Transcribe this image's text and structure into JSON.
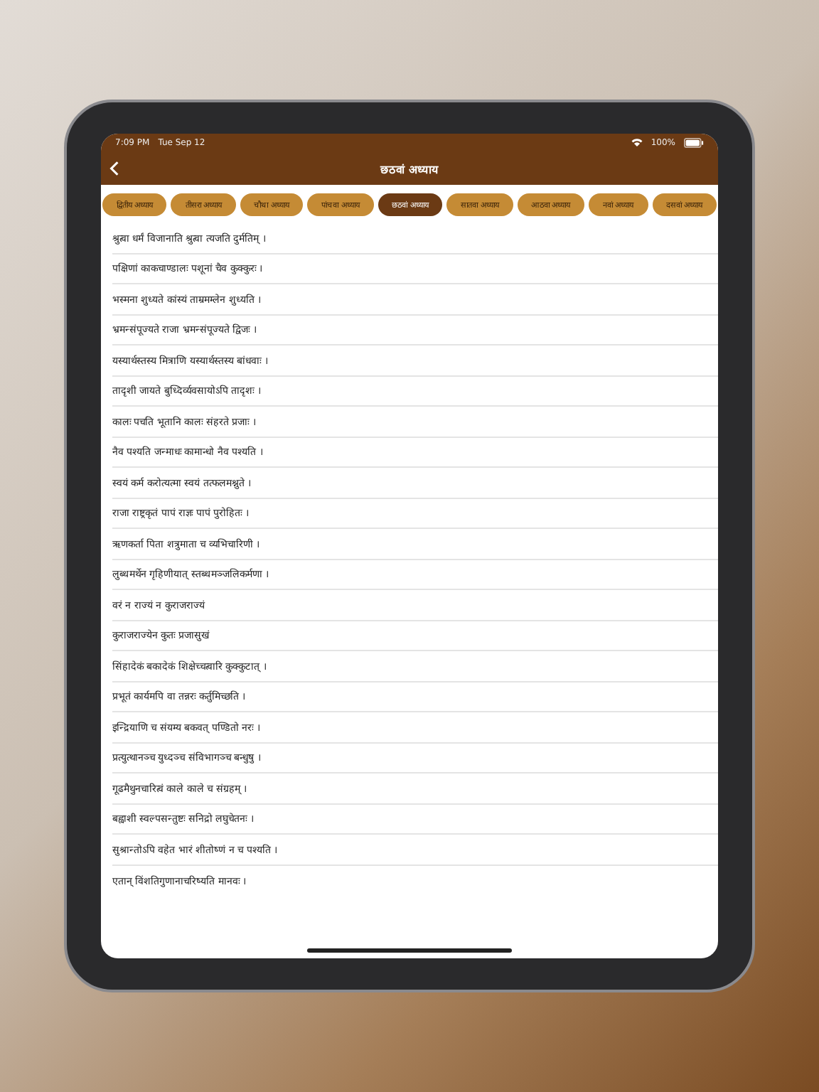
{
  "status_bar": {
    "time": "7:09 PM",
    "date": "Tue Sep 12",
    "battery": "100%"
  },
  "nav_bar": {
    "title": "छठवां अध्याय"
  },
  "tabs": [
    {
      "label": "द्वितीय अध्याय",
      "selected": false
    },
    {
      "label": "तीसरा अध्याय",
      "selected": false
    },
    {
      "label": "चौथा अध्याय",
      "selected": false
    },
    {
      "label": "पांचवा अध्याय",
      "selected": false
    },
    {
      "label": "छठवां अध्याय",
      "selected": true
    },
    {
      "label": "सातवा अध्याय",
      "selected": false
    },
    {
      "label": "आठवा अध्याय",
      "selected": false
    },
    {
      "label": "नवां अध्याय",
      "selected": false
    },
    {
      "label": "दसवां अध्याय",
      "selected": false
    }
  ],
  "verses": [
    "श्रुत्वा धर्मं विजानाति श्रुत्वा त्यजति दुर्मतिम् ।",
    "पक्षिणां काकचाण्डालः पशूनां चैव कुक्कुरः ।",
    "भस्मना शुध्यते कांस्यं ताम्रमम्लेन शुध्यति ।",
    "भ्रमन्संपूज्यते राजा भ्रमन्संपूज्यते द्विजः ।",
    "यस्यार्थस्तस्य मित्राणि यस्यार्थस्तस्य बांधवाः ।",
    "तादृशी जायते बुध्दिर्व्यवसायोऽपि तादृशः ।",
    "कालः पचति भूतानि कालः संहरते प्रजाः ।",
    "नैव पश्यति जन्माधः कामान्धो नैव पश्यति ।",
    "स्वयं कर्म करोत्यत्मा स्वयं तत्फलमश्नुते ।",
    "राजा राष्ट्रकृतं पापं राज्ञः पापं पुरोहितः ।",
    "ऋणकर्ता पिता शत्रुमाता च व्यभिचारिणी ।",
    "लुब्धमर्थेन गृहिणीयात् स्तब्धमञ्जलिकर्मणा ।",
    "वरं न राज्यं न कुराजराज्यं",
    "कुराजराज्येन कुतः प्रजासुखं",
    "सिंहादेकं बकादेकं शिक्षेच्चत्वारि कुक्कुटात् ।",
    "प्रभूतं कार्यमपि वा तन्नरः कर्तुमिच्छति ।",
    "इन्द्रियाणि च संयम्य बकवत् पण्डितो नरः ।",
    "प्रत्युत्थानञ्च युध्दञ्च संविभागञ्च बन्धुषु ।",
    "गूढमैथुनचारित्वं काले काले च संग्रहम् ।",
    "बह्वाशी स्वल्पसन्तुष्टः सनिद्रो लघुचेतनः ।",
    "सुश्रान्तोऽपि वहेत भारं शीतोष्णं न च पश्यति ।",
    "एतान् विंशतिगुणानाचरिष्यति मानवः ।"
  ]
}
